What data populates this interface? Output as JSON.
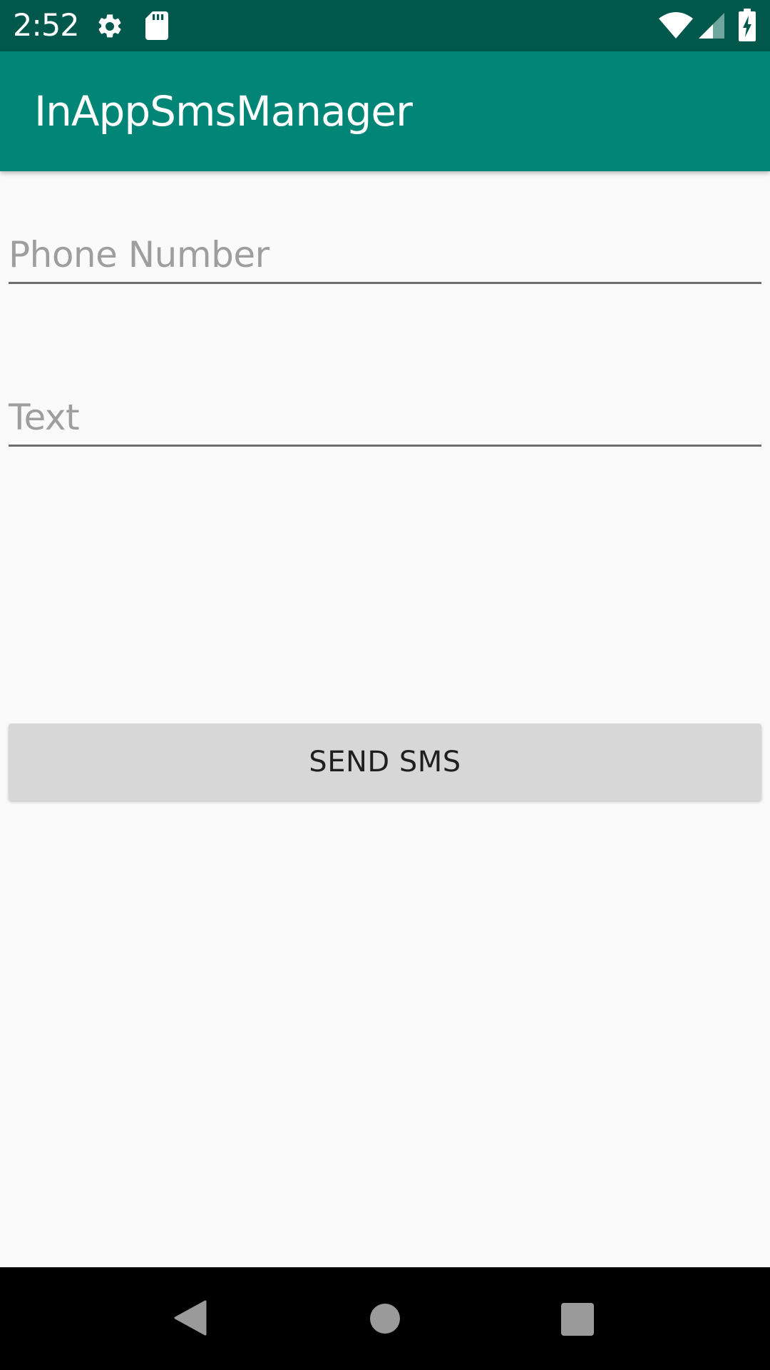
{
  "status_bar": {
    "time": "2:52",
    "icons": [
      "settings-icon",
      "sd-card-icon",
      "wifi-icon",
      "signal-icon",
      "battery-charging-icon"
    ],
    "background_color": "#00584d"
  },
  "app_bar": {
    "title": "InAppSmsManager",
    "background_color": "#008577"
  },
  "form": {
    "phone_field": {
      "placeholder": "Phone Number",
      "value": ""
    },
    "text_field": {
      "placeholder": "Text",
      "value": ""
    },
    "send_button_label": "SEND SMS"
  },
  "nav_bar": {
    "buttons": [
      "back-icon",
      "home-icon",
      "recents-icon"
    ]
  }
}
